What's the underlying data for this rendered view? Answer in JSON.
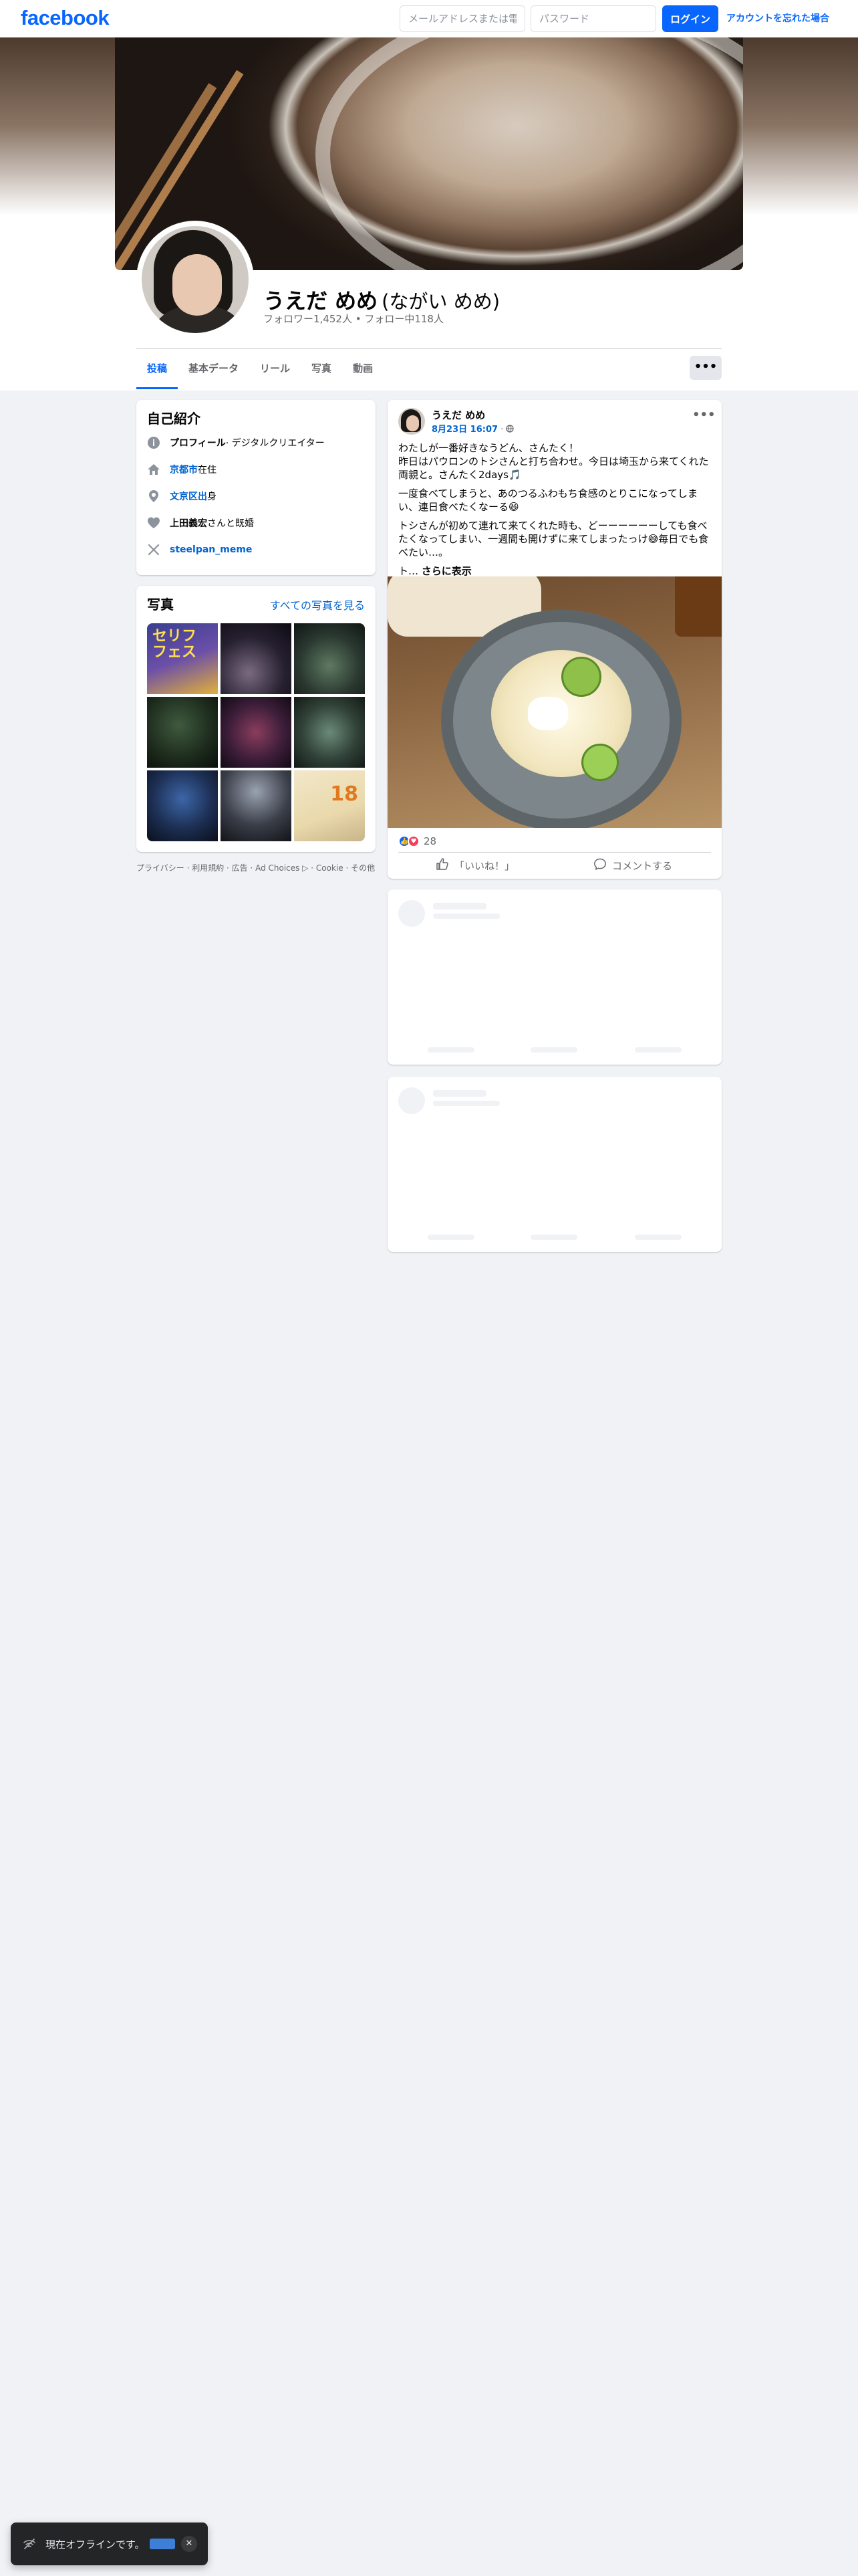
{
  "topbar": {
    "logo": "facebook",
    "email_placeholder": "メールアドレスまたは電",
    "password_placeholder": "パスワード",
    "login_label": "ログイン",
    "forgot_label": "アカウントを忘れた場合"
  },
  "profile": {
    "name": "うえだ めめ",
    "alt_name": "(ながい めめ)",
    "follow_text": "フォロワー1,452人 • フォロー中118人"
  },
  "tabs": [
    "投稿",
    "基本データ",
    "リール",
    "写真",
    "動画"
  ],
  "more_label": "•••",
  "intro": {
    "title": "自己紹介",
    "profile_prefix": "プロフィール",
    "profile_suffix": " · デジタルクリエイター",
    "city_link": "京都市",
    "city_suffix": "在住",
    "hometown_link": "文京区出",
    "hometown_suffix": "身",
    "spouse_name": "上田義宏",
    "spouse_suffix": "さんと既婚",
    "x_handle": "steelpan_meme"
  },
  "photos": {
    "title": "写真",
    "see_all": "すべての写真を見る",
    "tile1_text": "セリフ\nフェス",
    "tile9_text": "18"
  },
  "footer": "プライバシー · 利用規約 · 広告 · Ad Choices ▷ · Cookie · その他",
  "post": {
    "author": "うえだ めめ",
    "date": "8月23日 16:07",
    "date_sep": " · ",
    "menu": "•••",
    "line1": "わたしが一番好きなうどん、さんたく！",
    "line2": "昨日はパウロンのトシさんと打ち合わせ。今日は埼玉から来てくれた両親と。さんたく2days🎵",
    "line3": "一度食べてしまうと、あのつるふわもち食感のとりこになってしまい、連日食べたくなーる😆",
    "line4": "トシさんが初めて連れて来てくれた時も、どーーーーーーしても食べたくなってしまい、一週間も開けずに来てしまったっけ😅毎日でも食べたい…。",
    "line5_prefix": "ト… ",
    "see_more": "さらに表示",
    "reaction_count": "28",
    "like_label": "「いいね！」",
    "comment_label": "コメントする"
  },
  "toast": {
    "message": "現在オフラインです。",
    "close": "✕"
  },
  "colors": {
    "brand": "#0866ff",
    "link": "#0064d1",
    "background": "#f0f2f5"
  }
}
